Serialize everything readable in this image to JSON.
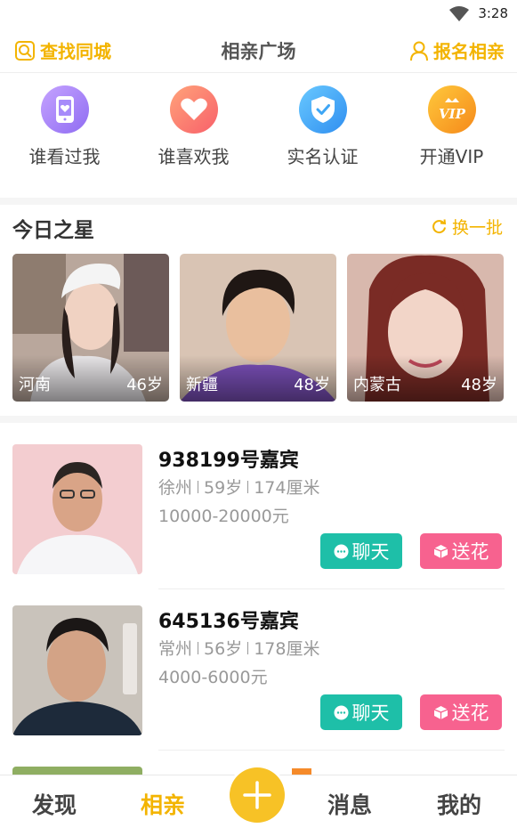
{
  "status_bar": {
    "time": "3:28"
  },
  "header": {
    "find_city": "查找同城",
    "title": "相亲广场",
    "signup": "报名相亲"
  },
  "quick_actions": [
    {
      "label": "谁看过我",
      "icon": "phone-heart-icon",
      "color": "#a78bfa"
    },
    {
      "label": "谁喜欢我",
      "icon": "heart-icon",
      "color": "#fb7b6b"
    },
    {
      "label": "实名认证",
      "icon": "shield-check-icon",
      "color": "#3ea6f5"
    },
    {
      "label": "开通VIP",
      "icon": "vip-crown-icon",
      "color": "#f7a31b"
    }
  ],
  "stars": {
    "title": "今日之星",
    "refresh_label": "换一批",
    "cards": [
      {
        "region": "河南",
        "age": "46岁"
      },
      {
        "region": "新疆",
        "age": "48岁"
      },
      {
        "region": "内蒙古",
        "age": "48岁"
      }
    ]
  },
  "guests": [
    {
      "name": "938199号嘉宾",
      "city": "徐州",
      "age": "59岁",
      "height": "174厘米",
      "income": "10000-20000元",
      "chat_label": "聊天",
      "flower_label": "送花"
    },
    {
      "name": "645136号嘉宾",
      "city": "常州",
      "age": "56岁",
      "height": "178厘米",
      "income": "4000-6000元",
      "chat_label": "聊天",
      "flower_label": "送花"
    }
  ],
  "bottom_nav": {
    "discover": "发现",
    "dating": "相亲",
    "messages": "消息",
    "mine": "我的",
    "active": "相亲"
  },
  "colors": {
    "accent": "#f3b400",
    "chat": "#1ebfa8",
    "flower": "#f7628f"
  }
}
